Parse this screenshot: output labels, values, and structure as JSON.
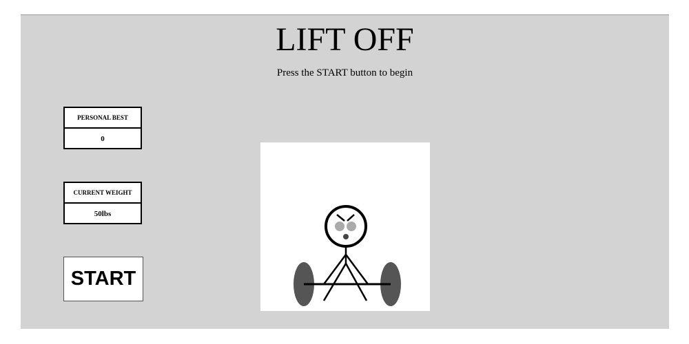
{
  "title": "LIFT OFF",
  "instructions": "Press the START button to begin",
  "personal_best": {
    "label": "PERSONAL BEST",
    "value": "0"
  },
  "current_weight": {
    "label": "CURRENT WEIGHT",
    "value": "50lbs"
  },
  "start_button": {
    "label": "START"
  },
  "scene": {
    "character": "stick-figure-lifter",
    "plate_color": "#555555",
    "eye_color": "#aaaaaa"
  },
  "colors": {
    "panel_background": "#d3d3d3",
    "box_background": "#ffffff",
    "text": "#000000"
  }
}
